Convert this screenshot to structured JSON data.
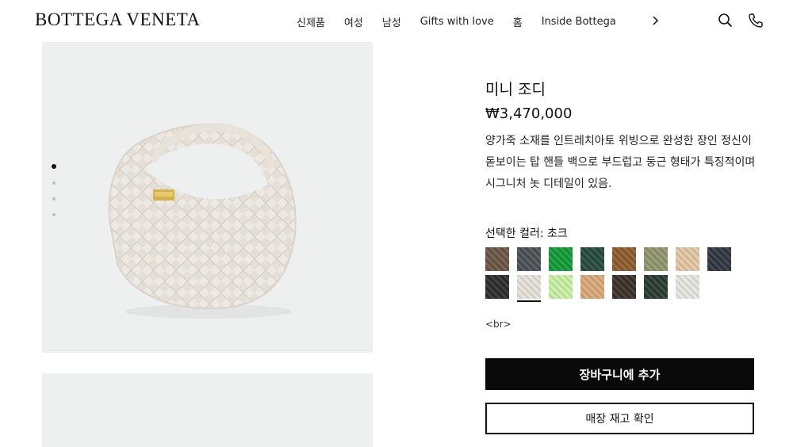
{
  "brand": {
    "logo_text": "BOTTEGA VENETA"
  },
  "nav": {
    "items": [
      "신제품",
      "여성",
      "남성",
      "Gifts with love",
      "홈",
      "Inside Bottega"
    ],
    "next_icon": "chevron-right-icon",
    "search_icon": "search-icon",
    "phone_icon": "phone-icon"
  },
  "gallery": {
    "image_count": 4,
    "active_index": 0
  },
  "product": {
    "name": "미니 조디",
    "price": "₩3,470,000",
    "description": "양가죽 소재를 인트레치아토 위빙으로 완성한 장인 정신이 돋보이는 탑 핸들 백으로 부드럽고 둥근 형태가 특징적이며 시그니처 놋 디테일이 있음.",
    "color_label": "선택한 컬러: 초크",
    "br_note": "<br>"
  },
  "colors": {
    "swatches": [
      "#6b5443",
      "#4a4f55",
      "#0f9a35",
      "#244a3c",
      "#8e5a2b",
      "#8f936b",
      "#e2c6a4",
      "#2e3540",
      "#2b2b2b",
      "#e6e0d8",
      "#c6f0a2",
      "#d8a676",
      "#3a2d27",
      "#273a30",
      "#e4e5de"
    ],
    "selected_index": 9
  },
  "actions": {
    "add_to_cart": "장바구니에 추가",
    "check_store_stock": "매장 재고 확인"
  }
}
